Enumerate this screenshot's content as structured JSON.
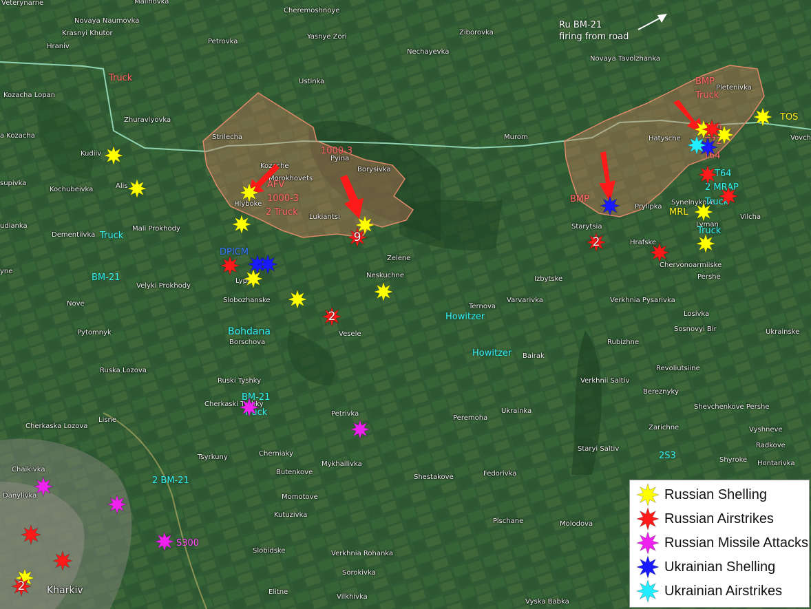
{
  "places": [
    {
      "id": "veterynarne",
      "text": "Veterynarne"
    },
    {
      "id": "malinovka",
      "text": "Malinovka"
    },
    {
      "id": "novaya-naumovka",
      "text": "Novaya Naumovka"
    },
    {
      "id": "krasnyi-khutor",
      "text": "Krasnyi Khutor"
    },
    {
      "id": "hraniv",
      "text": "Hraniv"
    },
    {
      "id": "cheremoshnoye",
      "text": "Cheremoshnoye"
    },
    {
      "id": "yasnye-zori",
      "text": "Yasnye Zori"
    },
    {
      "id": "zibrovka",
      "text": "Ziborovka"
    },
    {
      "id": "petrovka",
      "text": "Petrovka"
    },
    {
      "id": "nechayevka",
      "text": "Nechayevka"
    },
    {
      "id": "novaya-tavolzhanka",
      "text": "Novaya Tavolzhanka"
    },
    {
      "id": "ustinka",
      "text": "Ustinka"
    },
    {
      "id": "pletenivka",
      "text": "Pletenivka"
    },
    {
      "id": "kozacha-lopan-1",
      "text": "Kozacha Lopan"
    },
    {
      "id": "zhuravlyovka",
      "text": "Zhuravlyovka"
    },
    {
      "id": "strilecha",
      "text": "Strilecha"
    },
    {
      "id": "murom",
      "text": "Murom"
    },
    {
      "id": "hatysche",
      "text": "Hatysche"
    },
    {
      "id": "vovch",
      "text": "Vovch"
    },
    {
      "id": "kozacha-2",
      "text": "a Kozacha"
    },
    {
      "id": "kudiivka",
      "text": "Kudiiv"
    },
    {
      "id": "pyina",
      "text": "Pyina"
    },
    {
      "id": "borysivka",
      "text": "Borysivka"
    },
    {
      "id": "kozache",
      "text": "Kozache"
    },
    {
      "id": "morokhovets",
      "text": "Morokhovets"
    },
    {
      "id": "supivka",
      "text": "supivka"
    },
    {
      "id": "kochubeivka",
      "text": "Kochubeivka"
    },
    {
      "id": "alisivka",
      "text": "Alis"
    },
    {
      "id": "hlyboke",
      "text": "Hlyboke"
    },
    {
      "id": "lukiantsi",
      "text": "Lukiantsi"
    },
    {
      "id": "prylipka",
      "text": "Prylipka"
    },
    {
      "id": "synelnykove",
      "text": "Synelnykove"
    },
    {
      "id": "udianka",
      "text": "udianka"
    },
    {
      "id": "dementiivka",
      "text": "Dementiivka"
    },
    {
      "id": "mali-prokhody",
      "text": "Mali Prokhody"
    },
    {
      "id": "starytsia",
      "text": "Starytsia"
    },
    {
      "id": "lyman",
      "text": "Lyman"
    },
    {
      "id": "vilcha",
      "text": "Vilcha"
    },
    {
      "id": "hrafske",
      "text": "Hrafske"
    },
    {
      "id": "zelene",
      "text": "Zelene"
    },
    {
      "id": "chervonoarmiiske",
      "text": "Chervonoarmiiske"
    },
    {
      "id": "pershe",
      "text": "Pershe"
    },
    {
      "id": "velyki-prokhody",
      "text": "Velyki Prokhody"
    },
    {
      "id": "lypsi",
      "text": "Lypsi"
    },
    {
      "id": "neskuchne",
      "text": "Neskuchne"
    },
    {
      "id": "izbytske",
      "text": "Izbytske"
    },
    {
      "id": "slobozhanske",
      "text": "Slobozhanske"
    },
    {
      "id": "varvarivka",
      "text": "Varvarivka"
    },
    {
      "id": "verkhnia-pysarivka",
      "text": "Verkhnia Pysarivka"
    },
    {
      "id": "nove",
      "text": "Nove"
    },
    {
      "id": "ternova",
      "text": "Ternova"
    },
    {
      "id": "losivka",
      "text": "Losivka"
    },
    {
      "id": "yne",
      "text": "yne"
    },
    {
      "id": "pytomnyk",
      "text": "Pytomnyk"
    },
    {
      "id": "borschova",
      "text": "Borschova"
    },
    {
      "id": "vesele",
      "text": "Vesele"
    },
    {
      "id": "sosnovyi-bir",
      "text": "Sosnovyi Bir"
    },
    {
      "id": "ukrainske",
      "text": "Ukrainske"
    },
    {
      "id": "rubizhne",
      "text": "Rubizhne"
    },
    {
      "id": "bairak",
      "text": "Bairak"
    },
    {
      "id": "ruska-lozova",
      "text": "Ruska Lozova"
    },
    {
      "id": "revoliutsiine",
      "text": "Revoliutsiine"
    },
    {
      "id": "ruski-tyshky",
      "text": "Ruski Tyshky"
    },
    {
      "id": "verkhnii-saltiv",
      "text": "Verkhnii Saltiv"
    },
    {
      "id": "bereznyky",
      "text": "Bereznyky"
    },
    {
      "id": "ukrainka",
      "text": "Ukrainka"
    },
    {
      "id": "petrivka",
      "text": "Petrivka"
    },
    {
      "id": "shevchenkove-pershe",
      "text": "Shevchenkove Pershe"
    },
    {
      "id": "lisne",
      "text": "Lisne"
    },
    {
      "id": "peremoha",
      "text": "Peremoha"
    },
    {
      "id": "cherkaska-lozova",
      "text": "Cherkaska Lozova"
    },
    {
      "id": "zarichne",
      "text": "Zarichne"
    },
    {
      "id": "vyshneve",
      "text": "Vyshneve"
    },
    {
      "id": "radkove",
      "text": "Radkove"
    },
    {
      "id": "tsyrkuny",
      "text": "Tsyrkuny"
    },
    {
      "id": "cherniaky",
      "text": "Cherniaky"
    },
    {
      "id": "chaikivka",
      "text": "Chaikivka"
    },
    {
      "id": "staryi-saltiv",
      "text": "Staryi Saltiv"
    },
    {
      "id": "shyroke",
      "text": "Shyroke"
    },
    {
      "id": "hontarivka",
      "text": "Hontarivka"
    },
    {
      "id": "mykhailivka",
      "text": "Mykhailivka"
    },
    {
      "id": "butenkove",
      "text": "Butenkove"
    },
    {
      "id": "danylivka",
      "text": "Danylivka"
    },
    {
      "id": "shestakove",
      "text": "Shestakove"
    },
    {
      "id": "fedorivka",
      "text": "Fedorivka"
    },
    {
      "id": "momotove",
      "text": "Momotove"
    },
    {
      "id": "kutuzivka",
      "text": "Kutuzivka"
    },
    {
      "id": "pischane",
      "text": "Pischane"
    },
    {
      "id": "molodova",
      "text": "Molodova"
    },
    {
      "id": "slobidske",
      "text": "Slobidske"
    },
    {
      "id": "verkhnia-rohanka",
      "text": "Verkhnia Rohanka"
    },
    {
      "id": "sorokivka",
      "text": "Sorokivka"
    },
    {
      "id": "kharkiv",
      "text": "Kharkiv"
    },
    {
      "id": "elitne",
      "text": "Elitne"
    },
    {
      "id": "vilkhivka",
      "text": "Vilkhivka"
    },
    {
      "id": "vyska-babka",
      "text": "Vyska Babka"
    },
    {
      "id": "cherkaski-tyshky",
      "text": "Cherkaski Tyshky"
    }
  ],
  "annotations": [
    {
      "id": "bm21-road-1",
      "text": "Ru BM-21"
    },
    {
      "id": "bm21-road-2",
      "text": "firing from road"
    },
    {
      "id": "truck-nw",
      "text": "Truck"
    },
    {
      "id": "bmp-ne",
      "text": "BMP"
    },
    {
      "id": "truck-ne",
      "text": "Truck"
    },
    {
      "id": "tos",
      "text": "TOS"
    },
    {
      "id": "t80",
      "text": "T80"
    },
    {
      "id": "t72",
      "text": "T72"
    },
    {
      "id": "t64a",
      "text": "T64"
    },
    {
      "id": "ne-3",
      "text": "3"
    },
    {
      "id": "t64b",
      "text": "T64"
    },
    {
      "id": "mrap",
      "text": "2 MRAP"
    },
    {
      "id": "truck-lyman-1",
      "text": "Truck"
    },
    {
      "id": "truck-lyman-2",
      "text": "Truck"
    },
    {
      "id": "mrl",
      "text": "MRL"
    },
    {
      "id": "bmp-starytsia",
      "text": "BMP"
    },
    {
      "id": "1000-3-top",
      "text": "1000-3"
    },
    {
      "id": "afv",
      "text": "AFV"
    },
    {
      "id": "1000-3-hlyboke",
      "text": "1000-3"
    },
    {
      "id": "2-truck",
      "text": "2 Truck"
    },
    {
      "id": "truck-dementiivka",
      "text": "Truck"
    },
    {
      "id": "bm21-west",
      "text": "BM-21"
    },
    {
      "id": "dpicm",
      "text": "DPICM"
    },
    {
      "id": "bohdana",
      "text": "Bohdana"
    },
    {
      "id": "howitzer-1",
      "text": "Howitzer"
    },
    {
      "id": "howitzer-2",
      "text": "Howitzer"
    },
    {
      "id": "bm21-tyshky",
      "text": "BM-21"
    },
    {
      "id": "truck-tyshky",
      "text": "Truck"
    },
    {
      "id": "2-bm21",
      "text": "2 BM-21"
    },
    {
      "id": "2s3",
      "text": "2S3"
    },
    {
      "id": "s300",
      "text": "S300"
    }
  ],
  "markers": [
    {
      "type": "russian_shelling",
      "count": ""
    },
    {
      "type": "russian_shelling",
      "count": ""
    },
    {
      "type": "russian_shelling",
      "count": ""
    },
    {
      "type": "russian_shelling",
      "count": ""
    },
    {
      "type": "russian_shelling",
      "count": ""
    },
    {
      "type": "russian_shelling",
      "count": ""
    },
    {
      "type": "russian_shelling",
      "count": ""
    },
    {
      "type": "russian_shelling",
      "count": ""
    },
    {
      "type": "russian_shelling",
      "count": ""
    },
    {
      "type": "russian_shelling",
      "count": ""
    },
    {
      "type": "russian_shelling",
      "count": ""
    },
    {
      "type": "russian_shelling",
      "count": ""
    },
    {
      "type": "russian_shelling",
      "count": ""
    },
    {
      "type": "russian_shelling",
      "count": ""
    },
    {
      "type": "russian_airstrikes",
      "count": "9"
    },
    {
      "type": "russian_airstrikes",
      "count": ""
    },
    {
      "type": "russian_airstrikes",
      "count": "2"
    },
    {
      "type": "russian_airstrikes",
      "count": ""
    },
    {
      "type": "russian_airstrikes",
      "count": ""
    },
    {
      "type": "russian_airstrikes",
      "count": "2"
    },
    {
      "type": "russian_airstrikes",
      "count": ""
    },
    {
      "type": "russian_airstrikes",
      "count": ""
    },
    {
      "type": "russian_airstrikes",
      "count": ""
    },
    {
      "type": "russian_airstrikes",
      "count": ""
    },
    {
      "type": "russian_airstrikes",
      "count": "2"
    },
    {
      "type": "russian_missile_attacks",
      "count": ""
    },
    {
      "type": "russian_missile_attacks",
      "count": ""
    },
    {
      "type": "russian_missile_attacks",
      "count": ""
    },
    {
      "type": "russian_missile_attacks",
      "count": ""
    },
    {
      "type": "russian_missile_attacks",
      "count": ""
    },
    {
      "type": "ukrainian_shelling",
      "count": ""
    },
    {
      "type": "ukrainian_shelling",
      "count": ""
    },
    {
      "type": "ukrainian_shelling",
      "count": ""
    },
    {
      "type": "ukrainian_shelling",
      "count": ""
    },
    {
      "type": "ukrainian_airstrikes",
      "count": ""
    }
  ],
  "legend": [
    {
      "type": "russian_shelling",
      "label": "Russian Shelling"
    },
    {
      "type": "russian_airstrikes",
      "label": "Russian Airstrikes"
    },
    {
      "type": "russian_missile_attacks",
      "label": "Russian Missile Attacks"
    },
    {
      "type": "ukrainian_shelling",
      "label": "Ukrainian Shelling"
    },
    {
      "type": "ukrainian_airstrikes",
      "label": "Ukrainian Airstrikes"
    }
  ],
  "colors": {
    "russian_shelling": "#ffff00",
    "russian_airstrikes": "#ff1a1a",
    "russian_missile_attacks": "#ee22ee",
    "ukrainian_shelling": "#1a1aff",
    "ukrainian_airstrikes": "#22eeff",
    "advance_arrow": "#ff1a1a",
    "occupied_area": "#c87a5a",
    "border_line": "#9fe6c8"
  }
}
